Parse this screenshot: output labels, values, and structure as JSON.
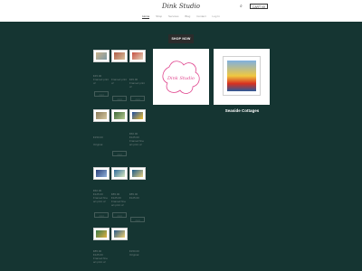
{
  "header": {
    "logo": "Dink Studio",
    "nav": [
      {
        "label": "Home",
        "active": true
      },
      {
        "label": "Shop"
      },
      {
        "label": "Services"
      },
      {
        "label": "Blog"
      },
      {
        "label": "Contact"
      },
      {
        "label": "Log In"
      }
    ],
    "search_icon": "search-icon",
    "cart_label": "CART (0)"
  },
  "hero": {
    "button_label": "SHOP NOW"
  },
  "products": [
    {
      "price": "",
      "title": ""
    },
    {
      "price": "",
      "title": ""
    },
    {
      "price": "",
      "title": ""
    },
    {
      "price": "€45.00",
      "title": "Framed print of"
    },
    {
      "price": "",
      "title": "Framed print of"
    },
    {
      "price": "€45.00",
      "title": "Framed print of"
    },
    {
      "price": "€150.00",
      "title": "Original"
    },
    {
      "price": "",
      "title": ""
    },
    {
      "price": "€60.00 €125.00",
      "title": "Framed fine art print of"
    },
    {
      "price": "€85.00 €125.00",
      "title": "Framed fine art print of"
    },
    {
      "price": "€85.00 €125.00",
      "title": ""
    },
    {
      "price": "€60.00 €125.00",
      "title": "Framed fine art print of"
    },
    {
      "price": "€85.00 €125.00",
      "title": ""
    },
    {
      "price": "€150.00",
      "title": "Original"
    }
  ],
  "buttons": {
    "add": "Add",
    "view": "View"
  },
  "feature": {
    "logo_text": "Dink Studio",
    "title": "Seaside Cottages"
  },
  "colors": {
    "background": "#153532",
    "header": "#ffffff",
    "button": "#2b2b2b",
    "accent_pink": "#e0478f"
  }
}
